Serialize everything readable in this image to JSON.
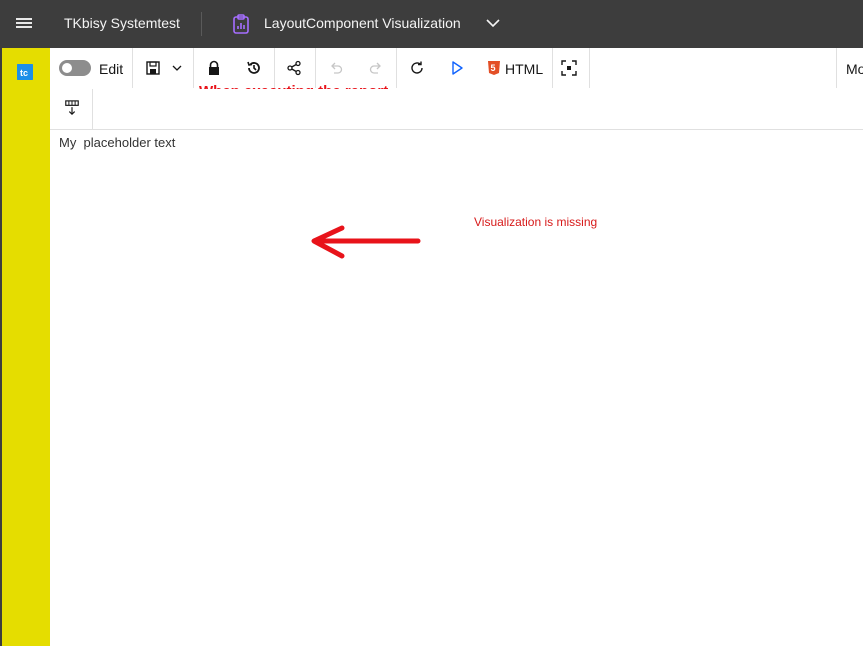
{
  "header": {
    "menu_icon": "hamburger-menu-icon",
    "brand": "TKbisy Systemtest",
    "report_icon": "clipboard-report-icon",
    "report_title": "LayoutComponent Visualization",
    "dropdown_icon": "chevron-down-icon"
  },
  "rail": {
    "logo_icon": "app-logo-icon",
    "color": "#e5dd00"
  },
  "toolbar": {
    "edit_label": "Edit",
    "edit_toggle_on": false,
    "save_icon": "save-icon",
    "save_menu_icon": "chevron-down-icon",
    "lock_icon": "lock-icon",
    "history_icon": "history-icon",
    "share_icon": "share-icon",
    "undo_icon": "undo-icon",
    "redo_icon": "redo-icon",
    "refresh_icon": "refresh-icon",
    "run_icon": "play-icon",
    "html_icon": "html5-icon",
    "html_label": "HTML",
    "fullscreen_icon": "focus-icon",
    "mode_label": "Mo"
  },
  "toolbar2": {
    "insert_icon": "insert-row-icon"
  },
  "annotations": {
    "executing": "When executing the report",
    "missing": "Visualization is missing",
    "arrow_icon": "red-arrow-left-icon",
    "color": "#e8131a"
  },
  "content": {
    "placeholder": "My  placeholder text"
  }
}
